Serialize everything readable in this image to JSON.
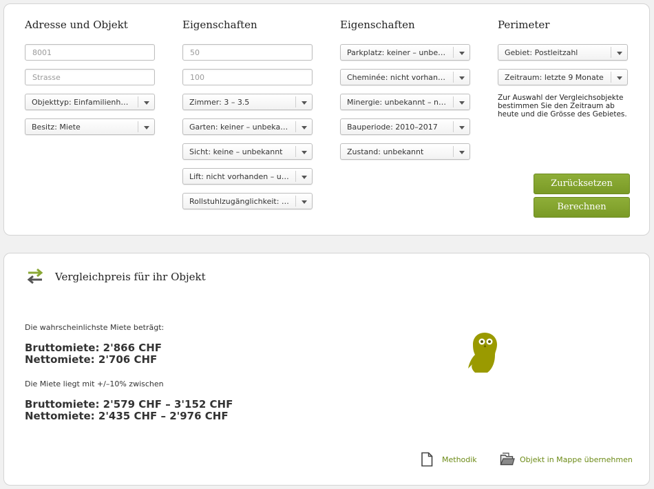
{
  "form": {
    "columns": [
      {
        "title": "Adresse und Objekt",
        "fields": [
          {
            "kind": "text",
            "value": "",
            "placeholder": "8001"
          },
          {
            "kind": "text",
            "value": "",
            "placeholder": "Strasse"
          },
          {
            "kind": "select",
            "label": "Objekttyp: Einfamilienhaus"
          },
          {
            "kind": "select",
            "label": "Besitz: Miete"
          }
        ]
      },
      {
        "title": "Eigenschaften",
        "fields": [
          {
            "kind": "text",
            "value": "",
            "placeholder": "50"
          },
          {
            "kind": "text",
            "value": "",
            "placeholder": "100"
          },
          {
            "kind": "select",
            "label": "Zimmer: 3 – 3.5"
          },
          {
            "kind": "select",
            "label": "Garten: keiner – unbekannt"
          },
          {
            "kind": "select",
            "label": "Sicht: keine – unbekannt"
          },
          {
            "kind": "select",
            "label": "Lift: nicht vorhanden – un..."
          },
          {
            "kind": "select",
            "label": "Rollstuhlzugänglichkeit: n..."
          }
        ]
      },
      {
        "title": "Eigenschaften",
        "fields": [
          {
            "kind": "select",
            "label": "Parkplatz: keiner – unbek..."
          },
          {
            "kind": "select",
            "label": "Cheminée: nicht vorhande..."
          },
          {
            "kind": "select",
            "label": "Minergie: unbekannt – nein"
          },
          {
            "kind": "select",
            "label": "Bauperiode: 2010–2017"
          },
          {
            "kind": "select",
            "label": "Zustand: unbekannt"
          }
        ]
      },
      {
        "title": "Perimeter",
        "fields": [
          {
            "kind": "select",
            "label": "Gebiet: Postleitzahl"
          },
          {
            "kind": "select",
            "label": "Zeitraum: letzte 9 Monate"
          }
        ]
      }
    ],
    "hint": "Zur Auswahl der Vergleichsobjekte bestimmen Sie den Zeitraum ab heute und die Grösse des Gebietes.",
    "reset_label": "Zurücksetzen",
    "calculate_label": "Berechnen"
  },
  "result": {
    "title": "Vergleichpreis für ihr Objekt",
    "likely_label": "Die wahrscheinlichste Miete beträgt:",
    "brutto": "Bruttomiete: 2'866 CHF",
    "netto": "Nettomiete: 2'706 CHF",
    "range_label": "Die Miete liegt mit +/–10% zwischen",
    "brutto_range": "Bruttomiete: 2'579 CHF – 3'152 CHF",
    "netto_range": "Nettomiete: 2'435 CHF – 2'976 CHF",
    "methodik_label": "Methodik",
    "mappe_label": "Objekt in Mappe übernehmen"
  },
  "icons": {
    "result": "swap-arrows-icon",
    "owl": "owl-icon",
    "methodik": "document-icon",
    "mappe": "folder-icon"
  },
  "colors": {
    "accent_green": "#7f9f2a",
    "link_green": "#6d8b17",
    "owl": "#9a9a00",
    "icon_gray": "#555555"
  }
}
